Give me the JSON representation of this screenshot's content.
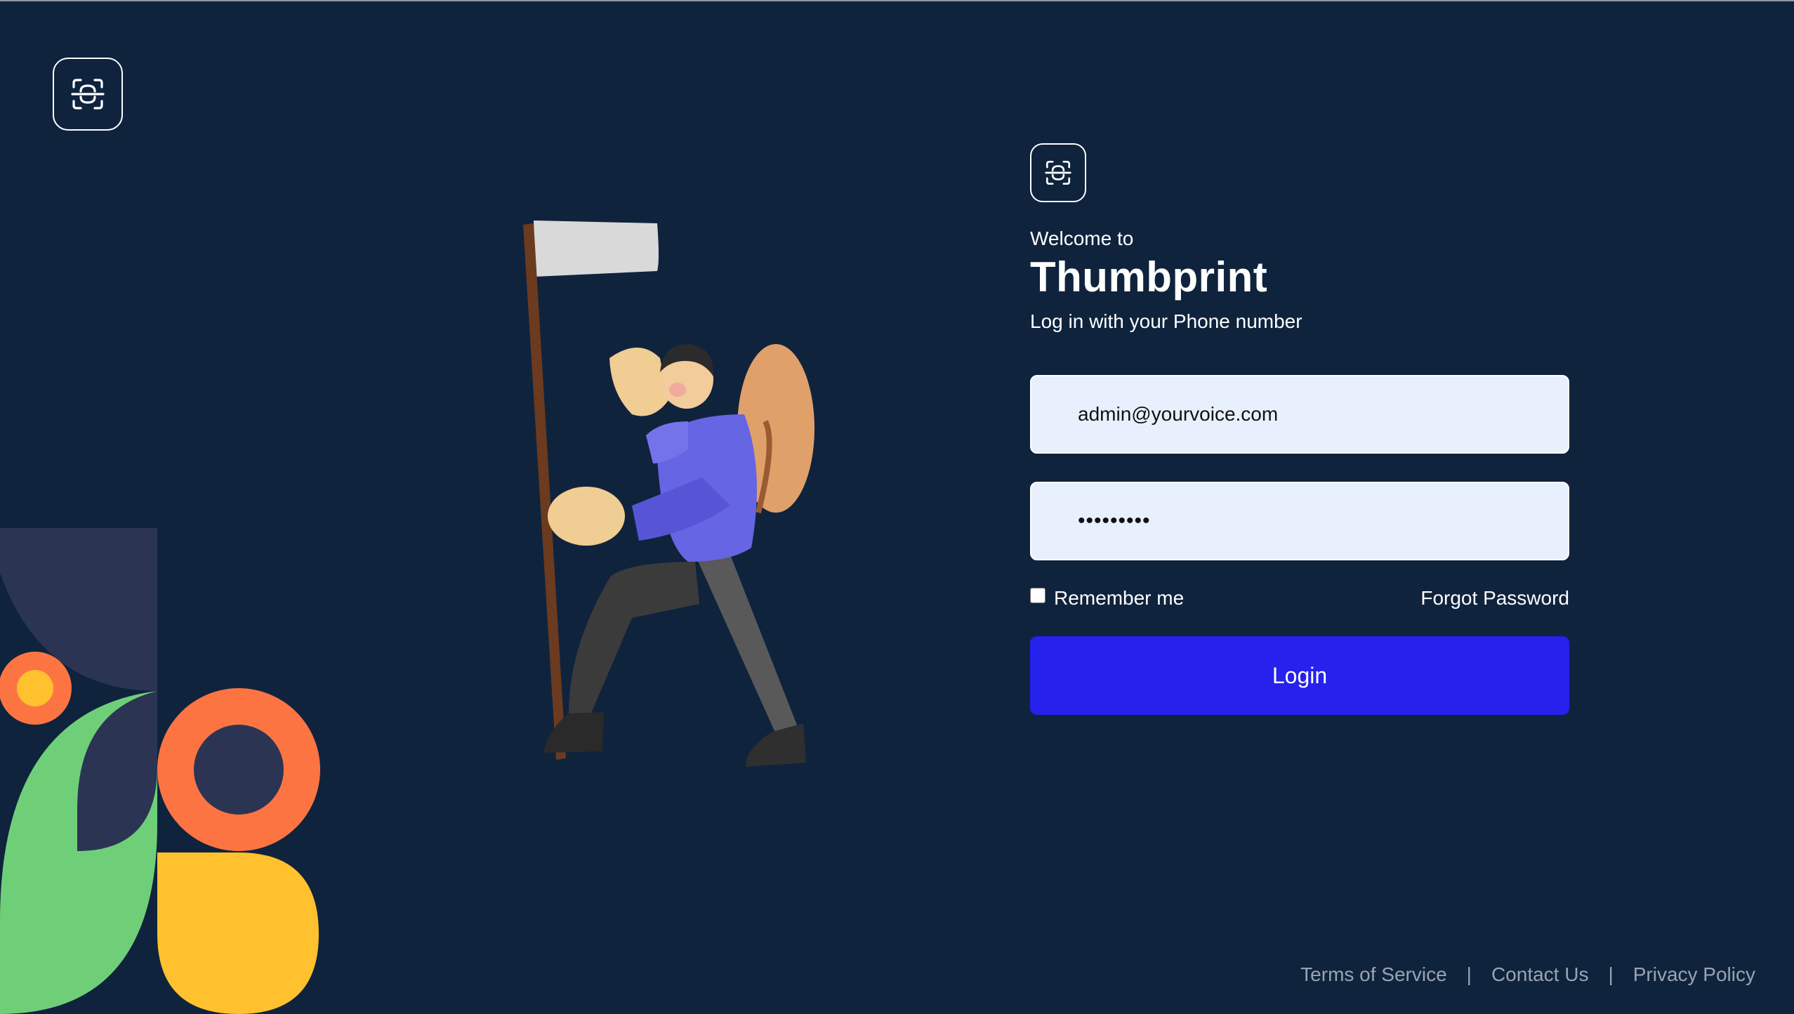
{
  "welcome": "Welcome to",
  "brand": "Thumbprint",
  "subtitle": "Log in with your Phone number",
  "email": {
    "value": "admin@yourvoice.com"
  },
  "password": {
    "masked_value": "•••••••••"
  },
  "remember_label": "Remember me",
  "forgot_label": "Forgot Password",
  "login_label": "Login",
  "footer": {
    "terms": "Terms of Service",
    "separator": "|",
    "contact": "Contact Us",
    "privacy": "Privacy Policy"
  },
  "icons": {
    "logo": "face-scan-icon"
  },
  "colors": {
    "background": "#0f233d",
    "field_bg": "#e8f0fd",
    "button": "#2621ed",
    "accent_orange": "#fd7443",
    "accent_green": "#6fcf79",
    "accent_yellow": "#ffc12d",
    "accent_navy": "#2b3553"
  }
}
